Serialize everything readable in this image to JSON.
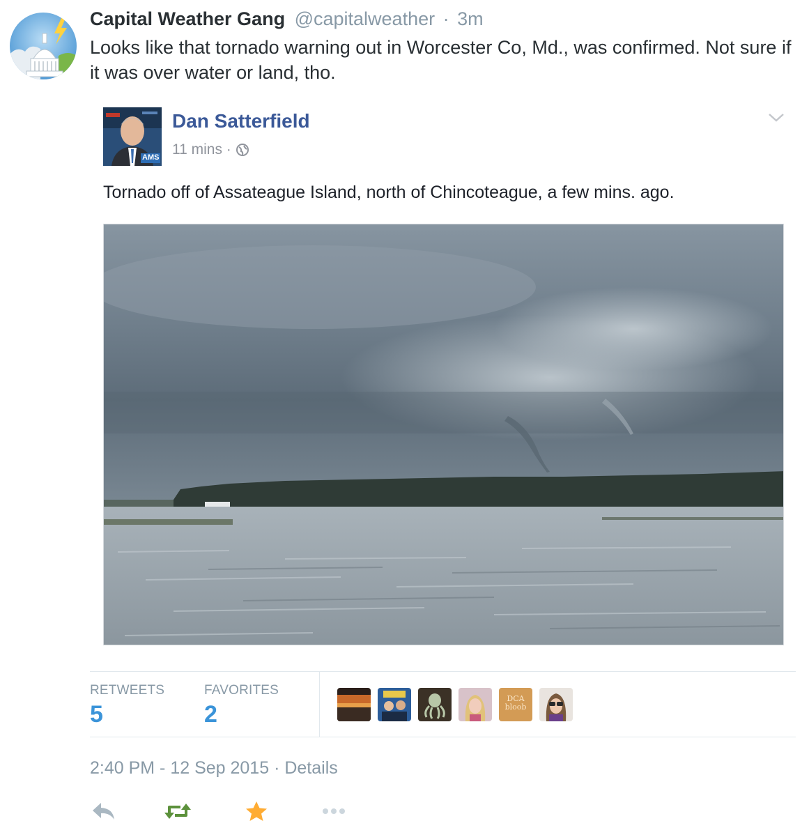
{
  "tweet": {
    "author_name": "Capital Weather Gang",
    "author_handle": "@capitalweather",
    "separator": "·",
    "time_ago": "3m",
    "text": "Looks like that tornado warning out in Worcester Co, Md., was confirmed. Not sure if it was over water or land, tho."
  },
  "embedded_post": {
    "author_name": "Dan Satterfield",
    "time_ago": "11 mins ·",
    "text": "Tornado off of Assateague Island, north of Chincoteague, a few mins. ago.",
    "avatar_badge": "AMS"
  },
  "stats": {
    "retweets_label": "RETWEETS",
    "retweets_value": "5",
    "favorites_label": "FAVORITES",
    "favorites_value": "2",
    "favoriter_avatar_text": "DCA bloob"
  },
  "timestamp": "2:40 PM - 12 Sep 2015 · Details",
  "colors": {
    "link_blue": "#3b94d9",
    "facebook_blue": "#3b5998",
    "muted_gray": "#8899a6",
    "retweet_green": "#5c913b",
    "favorite_gold": "#ffac33"
  },
  "icons": [
    "reply-icon",
    "retweet-icon",
    "favorite-icon",
    "more-icon",
    "globe-icon",
    "chevron-down-icon"
  ]
}
